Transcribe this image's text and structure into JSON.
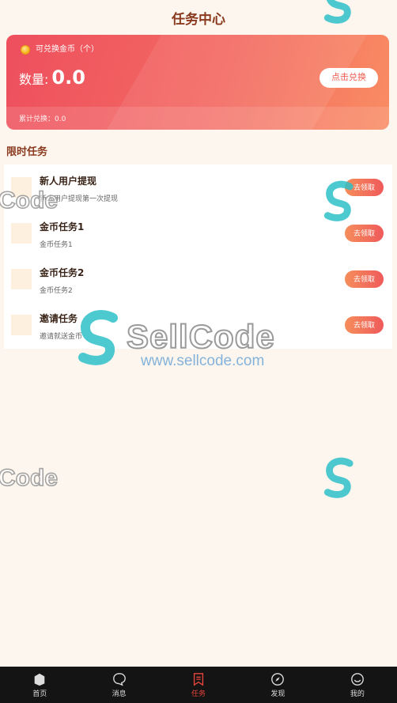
{
  "header": {
    "title": "任务中心"
  },
  "card": {
    "label": "可兑换金币（个）",
    "amount_label": "数量:",
    "amount_value": "0.0",
    "redeem_label": "点击兑换",
    "total_text": "累计兑换：0.0"
  },
  "section_title": "限时任务",
  "tasks": [
    {
      "title": "新人用户提现",
      "desc": "新人用户提现第一次提现",
      "button": "去领取"
    },
    {
      "title": "金币任务1",
      "desc": "金币任务1",
      "button": "去领取"
    },
    {
      "title": "金币任务2",
      "desc": "金币任务2",
      "button": "去领取"
    },
    {
      "title": "邀请任务",
      "desc": "邀请就送金币",
      "button": "去领取"
    }
  ],
  "tabbar": {
    "items": [
      {
        "label": "首页",
        "icon": "home-icon"
      },
      {
        "label": "消息",
        "icon": "chat-icon"
      },
      {
        "label": "任务",
        "icon": "task-icon",
        "active": true
      },
      {
        "label": "发现",
        "icon": "compass-icon"
      },
      {
        "label": "我的",
        "icon": "profile-icon"
      }
    ]
  },
  "watermark": {
    "brand": "SellCode",
    "url": "www.sellcode.com",
    "fragment": "Code"
  },
  "colors": {
    "accent": "#e8453c",
    "card_start": "#ee4f5d",
    "card_end": "#f98c63",
    "title": "#8a3a1e"
  }
}
